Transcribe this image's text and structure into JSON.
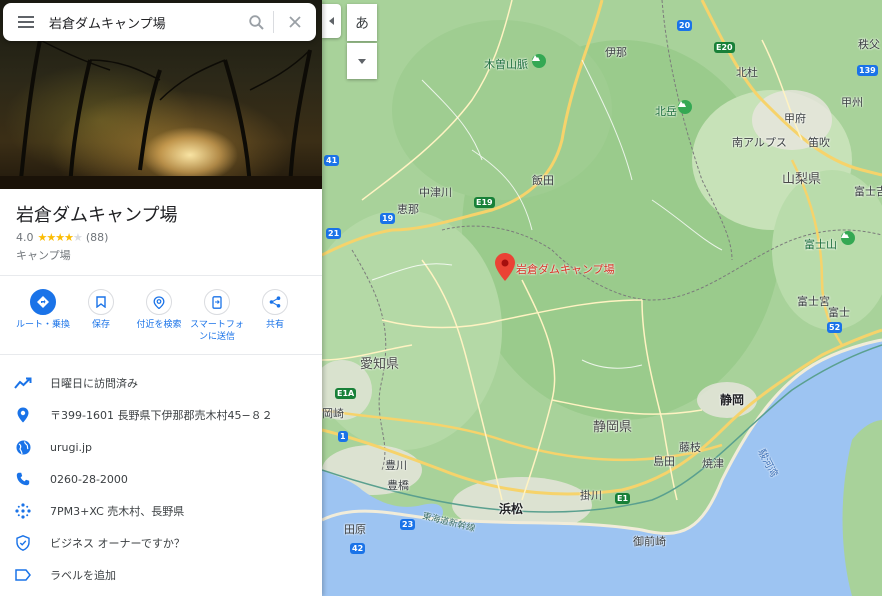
{
  "search": {
    "query": "岩倉ダムキャンプ場"
  },
  "place": {
    "name": "岩倉ダムキャンプ場",
    "rating": "4.0",
    "review_count": "(88)",
    "category": "キャンプ場"
  },
  "actions": [
    {
      "label": "ルート・乗換",
      "icon": "directions-icon"
    },
    {
      "label": "保存",
      "icon": "bookmark-icon"
    },
    {
      "label": "付近を検索",
      "icon": "nearby-icon"
    },
    {
      "label": "スマートフォンに送信",
      "icon": "send-to-phone-icon"
    },
    {
      "label": "共有",
      "icon": "share-icon"
    }
  ],
  "info": {
    "popular_times": "日曜日に訪問済み",
    "address": "〒399-1601 長野県下伊那郡売木村45−８２",
    "website": "urugi.jp",
    "phone": "0260-28-2000",
    "plus_code": "7PM3+XC 売木村、長野県",
    "claim": "ビジネス オーナーですか？",
    "label": "ラベルを追加"
  },
  "map": {
    "lang_button": "あ",
    "marker_label": "岩倉ダムキャンプ場",
    "labels": {
      "kiso": "木曽山脈",
      "ina": "伊那",
      "hokuto": "北杜",
      "kitadake": "北岳",
      "minami_alps": "南アルプス",
      "kofu": "甲府",
      "kai": "甲州",
      "chichibu": "秩父",
      "fuefuki": "笛吹",
      "yamanashi": "山梨県",
      "fujiyoshida": "富士吉",
      "iida": "飯田",
      "nakatsugawa": "中津川",
      "ena": "恵那",
      "fuji": "富士山",
      "fujinomiya": "富士宮",
      "fujicity": "富士",
      "aichi": "愛知県",
      "shizuoka_pref": "静岡県",
      "shizuoka": "静岡",
      "fujieda": "藤枝",
      "shimada": "島田",
      "yaizu": "焼津",
      "toyokawa": "豊川",
      "toyohashi": "豊橋",
      "hamamatsu": "浜松",
      "kakegawa": "掛川",
      "tahara": "田原",
      "omaezaki": "御前崎",
      "shinkansen": "東海道新幹線",
      "suruga": "駿河湾",
      "okazaki": "岡崎"
    },
    "shields": {
      "r20": "20",
      "e20": "E20",
      "r52": "52",
      "r19": "19",
      "e19": "E19",
      "r41": "41",
      "r21": "21",
      "r1": "1",
      "e1a": "E1A",
      "r23": "23",
      "r42": "42",
      "e1": "E1",
      "r139": "139"
    }
  }
}
